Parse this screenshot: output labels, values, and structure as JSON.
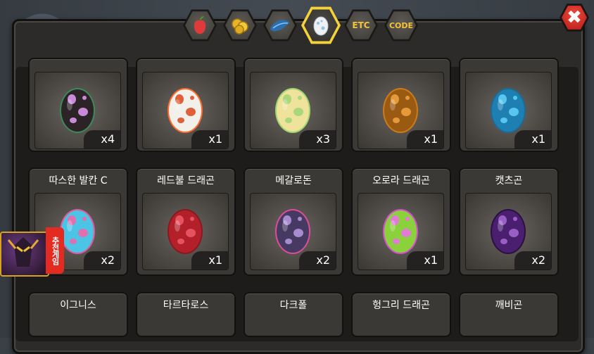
{
  "tabs": [
    {
      "icon": "fruit-icon",
      "label": ""
    },
    {
      "icon": "gold-coins-icon",
      "label": ""
    },
    {
      "icon": "feather-icon",
      "label": ""
    },
    {
      "icon": "egg-icon",
      "label": "",
      "active": true
    },
    {
      "icon": "etc-icon",
      "label": "ETC"
    },
    {
      "icon": "code-icon",
      "label": "CODE"
    }
  ],
  "row1": [
    {
      "count": "x4",
      "color": "#2b2326",
      "spots": "#c88ad9",
      "rim": "#3c8a5a"
    },
    {
      "count": "x1",
      "color": "#f2f0ea",
      "spots": "#e0603a",
      "rim": "#ff6a2a"
    },
    {
      "count": "x3",
      "color": "#efe29a",
      "spots": "#a9d77a",
      "rim": "#9fd66e"
    },
    {
      "count": "x1",
      "color": "#9a5a12",
      "spots": "#e59a3a",
      "rim": "#d07a18"
    },
    {
      "count": "x1",
      "color": "#1e7fb3",
      "spots": "#58c6ef",
      "rim": "#1d6b93"
    }
  ],
  "row2": [
    {
      "name": "따스한 발칸 C",
      "count": "x2",
      "color": "#4cc4e6",
      "spots": "#e070b0",
      "rim": "#e25a9c"
    },
    {
      "name": "레드불 드래곤",
      "count": "x1",
      "color": "#b3202a",
      "spots": "#e55360",
      "rim": "#8a1820"
    },
    {
      "name": "메갈로돈",
      "count": "x2",
      "color": "#473a62",
      "spots": "#a88ccf",
      "rim": "#e04c9a"
    },
    {
      "name": "오로라 드래곤",
      "count": "x1",
      "color": "#8ad13c",
      "spots": "#e17bd6",
      "rim": "#d64dd4"
    },
    {
      "name": "캣츠곤",
      "count": "x2",
      "color": "#4a1f70",
      "spots": "#9a5fc4",
      "rim": "#2b1042"
    }
  ],
  "row3": [
    {
      "name": "이그니스"
    },
    {
      "name": "타르타로스"
    },
    {
      "name": "다크폴"
    },
    {
      "name": "헝그리 드래곤"
    },
    {
      "name": "깨비곤"
    }
  ],
  "promo": {
    "label": "추천게임"
  },
  "close": {
    "symbol": "✖"
  }
}
